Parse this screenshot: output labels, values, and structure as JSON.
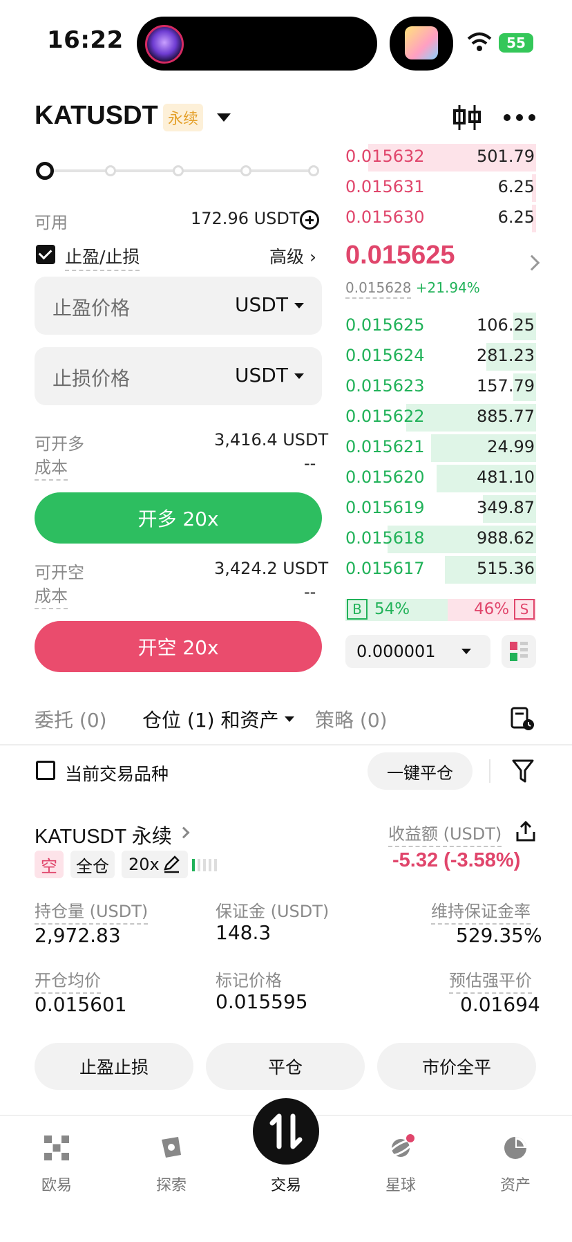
{
  "status_bar": {
    "time": "16:22",
    "battery": "55"
  },
  "header": {
    "symbol": "KATUSDT",
    "badge": "永续"
  },
  "form": {
    "available_label": "可用",
    "available_value": "172.96 USDT",
    "tpsl_label": "止盈/止损",
    "advanced_label": "高级 ›",
    "tp_placeholder": "止盈价格",
    "sl_placeholder": "止损价格",
    "unit": "USDT",
    "long_open_label": "可开多",
    "long_open_value": "3,416.4 USDT",
    "long_cost_label": "成本",
    "long_cost_value": "--",
    "long_button": "开多 20x",
    "short_open_label": "可开空",
    "short_open_value": "3,424.2 USDT",
    "short_cost_label": "成本",
    "short_cost_value": "--",
    "short_button": "开空 20x"
  },
  "orderbook": {
    "asks": [
      {
        "price": "0.015632",
        "qty": "501.79",
        "depth": 0.88
      },
      {
        "price": "0.015631",
        "qty": "6.25",
        "depth": 0.02
      },
      {
        "price": "0.015630",
        "qty": "6.25",
        "depth": 0.02
      }
    ],
    "last_price": "0.015625",
    "mark_price": "0.015628",
    "change": "+21.94%",
    "bids": [
      {
        "price": "0.015625",
        "qty": "106.25",
        "depth": 0.12
      },
      {
        "price": "0.015624",
        "qty": "281.23",
        "depth": 0.26
      },
      {
        "price": "0.015623",
        "qty": "157.79",
        "depth": 0.12
      },
      {
        "price": "0.015622",
        "qty": "885.77",
        "depth": 0.68
      },
      {
        "price": "0.015621",
        "qty": "24.99",
        "depth": 0.55
      },
      {
        "price": "0.015620",
        "qty": "481.10",
        "depth": 0.52
      },
      {
        "price": "0.015619",
        "qty": "349.87",
        "depth": 0.28
      },
      {
        "price": "0.015618",
        "qty": "988.62",
        "depth": 0.78
      },
      {
        "price": "0.015617",
        "qty": "515.36",
        "depth": 0.48
      }
    ],
    "buy_ratio_label": "B",
    "buy_ratio": "54%",
    "sell_ratio": "46%",
    "sell_ratio_label": "S",
    "tick_size": "0.000001"
  },
  "tabs": {
    "orders": "委托 (0)",
    "positions": "仓位 (1) 和资产",
    "strategies": "策略 (0)"
  },
  "filter_bar": {
    "current_only": "当前交易品种",
    "close_all": "一键平仓"
  },
  "position": {
    "title": "KATUSDT 永续",
    "pnl_label": "收益额 (USDT)",
    "pnl_value": "-5.32 (-3.58%)",
    "side_tag": "空",
    "margin_tag": "全仓",
    "leverage_tag": "20x",
    "size_label": "持仓量 (USDT)",
    "size_value": "2,972.83",
    "margin_label": "保证金 (USDT)",
    "margin_value": "148.3",
    "mmr_label": "维持保证金率",
    "mmr_value": "529.35%",
    "entry_label": "开仓均价",
    "entry_value": "0.015601",
    "mark_label": "标记价格",
    "mark_value": "0.015595",
    "liq_label": "预估强平价",
    "liq_value": "0.01694",
    "btn_tpsl": "止盈止损",
    "btn_close": "平仓",
    "btn_market_close": "市价全平"
  },
  "nav": [
    {
      "label": "欧易",
      "icon": "okx-logo-icon"
    },
    {
      "label": "探索",
      "icon": "compass-icon"
    },
    {
      "label": "交易",
      "icon": "trade-arrows-icon"
    },
    {
      "label": "星球",
      "icon": "planet-icon"
    },
    {
      "label": "资产",
      "icon": "pie-chart-icon"
    }
  ],
  "colors": {
    "green": "#2dbe60",
    "red": "#ea4c6d",
    "accent_gold": "#e4a02a"
  }
}
